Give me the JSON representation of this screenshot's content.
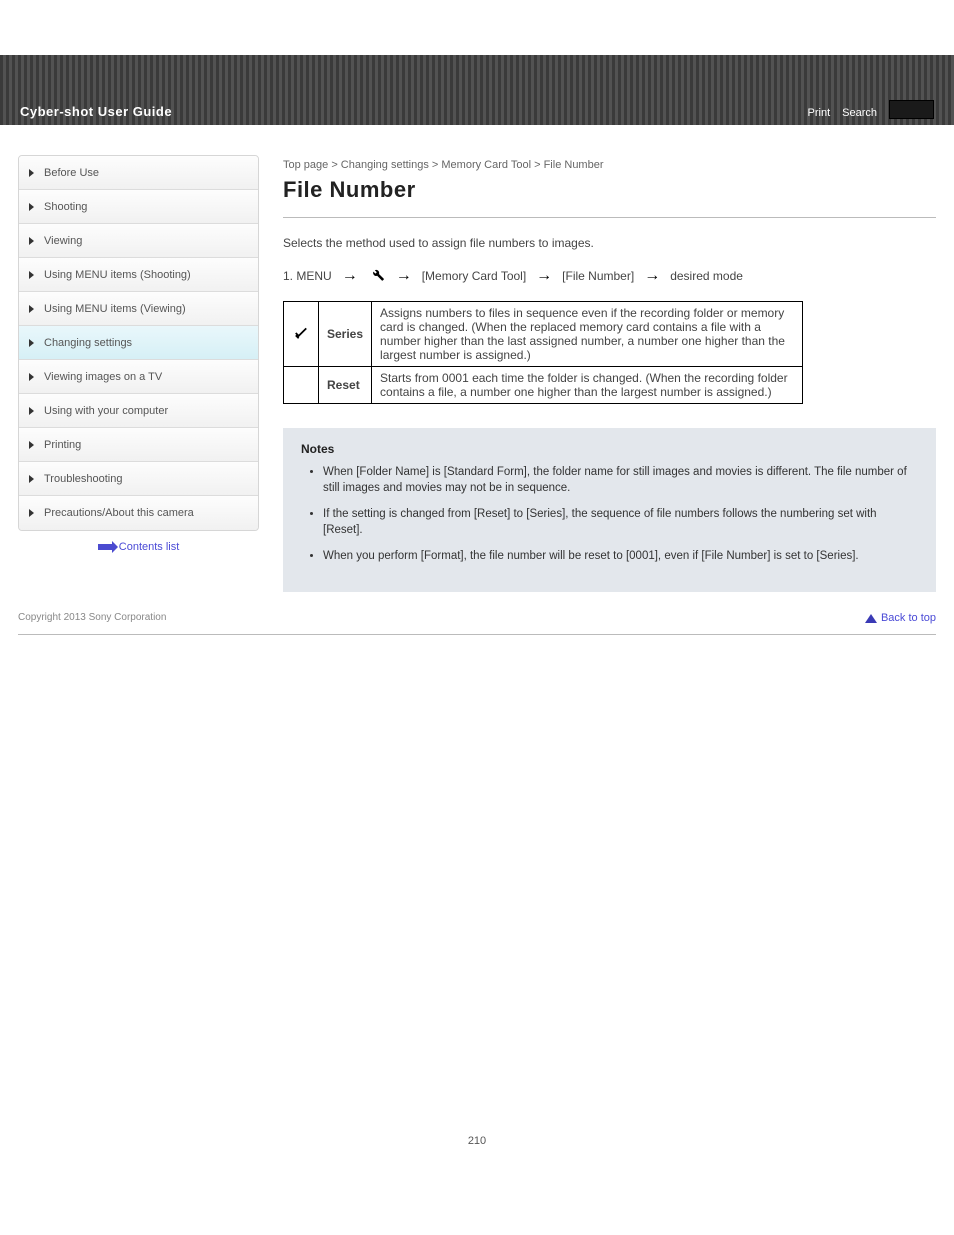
{
  "banner": {
    "title": "Cyber-shot User Guide",
    "print_label": "Print",
    "search_label": "Search"
  },
  "sidebar": {
    "items": [
      {
        "label": "Before Use",
        "active": false
      },
      {
        "label": "Shooting",
        "active": false
      },
      {
        "label": "Viewing",
        "active": false
      },
      {
        "label": "Using MENU items (Shooting)",
        "active": false
      },
      {
        "label": "Using MENU items (Viewing)",
        "active": false
      },
      {
        "label": "Changing settings",
        "active": true
      },
      {
        "label": "Viewing images on a TV",
        "active": false
      },
      {
        "label": "Using with your computer",
        "active": false
      },
      {
        "label": "Printing",
        "active": false
      },
      {
        "label": "Troubleshooting",
        "active": false
      },
      {
        "label": "Precautions/About this camera",
        "active": false
      }
    ],
    "back_label": "Contents list"
  },
  "content": {
    "breadcrumb": "Top page > Changing settings > Memory Card Tool > File Number",
    "heading": "File Number",
    "intro": "Selects the method used to assign file numbers to images.",
    "path": {
      "step1": "1. MENU",
      "step3": "[Memory Card Tool]",
      "step4": "[File Number]",
      "step5": "desired mode"
    },
    "options": [
      {
        "checked": true,
        "name": "Series",
        "desc": "Assigns numbers to files in sequence even if the recording folder or memory card is changed. (When the replaced memory card contains a file with a number higher than the last assigned number, a number one higher than the largest number is assigned.)"
      },
      {
        "checked": false,
        "name": "Reset",
        "desc": "Starts from 0001 each time the folder is changed. (When the recording folder contains a file, a number one higher than the largest number is assigned.)"
      }
    ],
    "notes_title": "Notes",
    "notes": [
      "When [Folder Name] is [Standard Form], the folder name for still images and movies is different. The file number of still images and movies may not be in sequence.",
      "If the setting is changed from [Reset] to [Series], the sequence of file numbers follows the numbering set with [Reset].",
      "When you perform [Format], the file number will be reset to [0001], even if [File Number] is set to [Series]."
    ]
  },
  "footer": {
    "copyright": "Copyright 2013 Sony Corporation",
    "back_to_top": "Back to top"
  },
  "page_number": "210"
}
